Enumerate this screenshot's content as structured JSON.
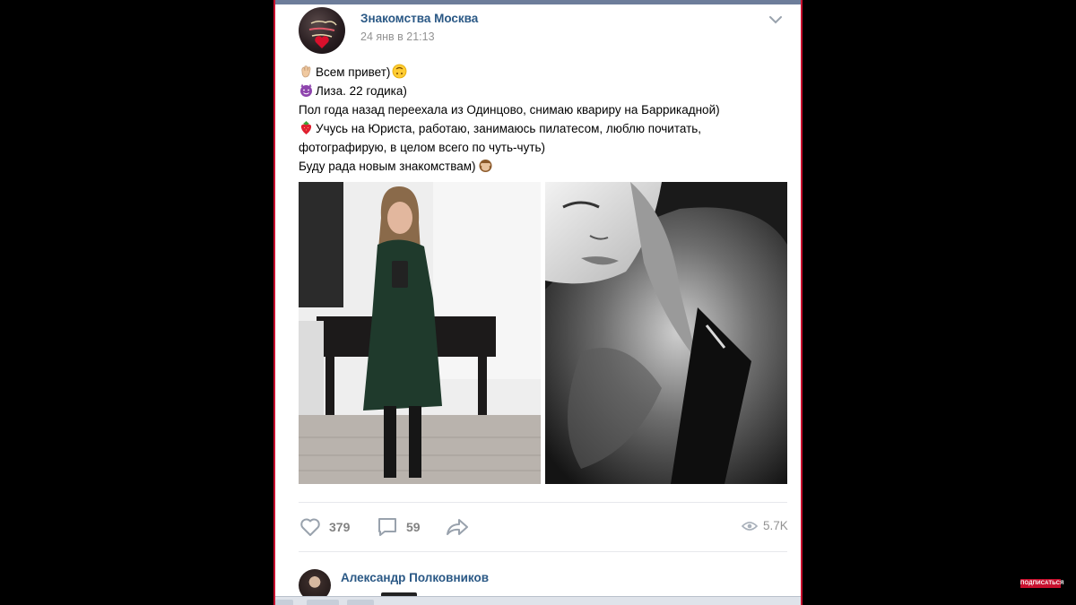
{
  "post": {
    "group_name": "Знакомства Москва",
    "date": "24 янв в 21:13",
    "avatar_icon": "group-logo-heart",
    "text_lines": [
      {
        "icon": "waving-hand",
        "text": "Всем привет)",
        "trailing_icon": "upside-down-face"
      },
      {
        "icon": "smiling-devil",
        "text": "Лиза. 22 годика)"
      },
      {
        "text": "Пол года назад переехала из Одинцово, снимаю квариру на Баррикадной)"
      },
      {
        "icon": "strawberry",
        "text": "Учусь на Юриста, работаю, занимаюсь пилатесом, люблю почитать,"
      },
      {
        "text": "фотографирую, в целом всего по чуть-чуть)"
      },
      {
        "text": "Буду рада новым знакомствам)",
        "trailing_icon": "see-no-evil-monkey"
      }
    ],
    "photos": [
      {
        "name": "mirror-selfie-green-dress",
        "tone": "color"
      },
      {
        "name": "fur-hood-selfie",
        "tone": "monochrome"
      }
    ],
    "actions": {
      "likes": "379",
      "comments": "59",
      "views": "5.7K"
    }
  },
  "comment": {
    "author": "Александр Полковников"
  },
  "overlay": {
    "badge": "ПОДПИСАТЬСЯ"
  },
  "colors": {
    "link": "#2a5885",
    "muted": "#939393",
    "icon": "#99a2ad",
    "frame_border": "#c8102e"
  }
}
